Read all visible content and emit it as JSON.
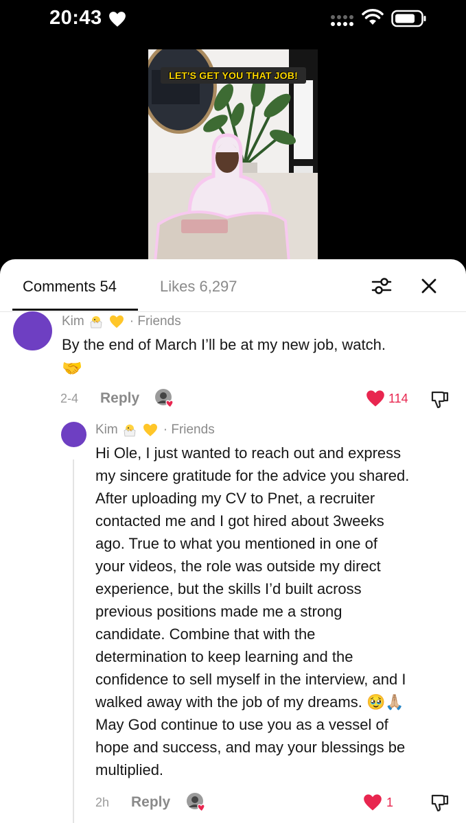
{
  "status_bar": {
    "time": "20:43"
  },
  "video": {
    "caption": "LET'S GET YOU THAT JOB!"
  },
  "tabs": {
    "comments": "Comments 54",
    "likes": "Likes 6,297"
  },
  "comment": {
    "author": "Kim",
    "separator": "· Friends",
    "text": "By the end of March I’ll be at my new job, watch.",
    "emoji": "🤝",
    "date": "2-4",
    "reply_label": "Reply",
    "like_count": "114"
  },
  "reply": {
    "author": "Kim",
    "separator": "· Friends",
    "text_lines": [
      "Hi Ole, I just wanted to reach out and express",
      "my sincere gratitude for the advice you shared.",
      "After uploading my CV to Pnet, a recruiter",
      "contacted me and I got hired about 3weeks",
      "ago. True to what you mentioned in one of",
      "your videos, the role was outside my direct",
      "experience, but the skills I’d built across",
      "previous positions made me a strong",
      "candidate. Combine that with the",
      "determination to keep learning and the",
      "confidence to sell myself in the interview, and I",
      "walked away with the job of my dreams. 🥹🙏🏼",
      "May God continue to use you as a vessel of",
      "hope and success, and may your blessings be",
      "multiplied."
    ],
    "date": "2h",
    "reply_label": "Reply",
    "like_count": "1"
  },
  "colors": {
    "like_red": "#e8264f",
    "avatar_purple": "#6e3fc2"
  }
}
